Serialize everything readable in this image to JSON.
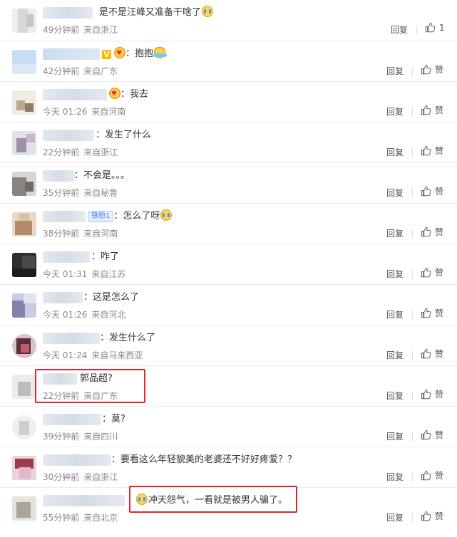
{
  "actions": {
    "reply_label": "回复",
    "like_label": "赞"
  },
  "colors": {
    "highlight": "#e8232b",
    "badge_blue": "#4b7ee8"
  },
  "comments": [
    {
      "text": "是不是汪峰又准备干啥了",
      "time": "49分钟前",
      "location": "来自浙江",
      "like": "1",
      "emoji_after": "cry-laugh"
    },
    {
      "text": "：抱抱",
      "time": "42分钟前",
      "location": "来自广东",
      "like": "赞",
      "emoji_before": "heart-eyes",
      "emoji_after": "hug"
    },
    {
      "text": "：我去",
      "time": "今天 01:26",
      "location": "来自河南",
      "like": "赞",
      "emoji_before": "heart-eyes"
    },
    {
      "text": "：发生了什么",
      "time": "22分钟前",
      "location": "来自浙江",
      "like": "赞"
    },
    {
      "text": "：不会是。。。",
      "time": "35分钟前",
      "location": "来自秘鲁",
      "like": "赞"
    },
    {
      "text": "：怎么了呀",
      "time": "38分钟前",
      "location": "来自河南",
      "like": "赞",
      "badge": "铁粉1",
      "emoji_after": "crying"
    },
    {
      "text": "：咋了",
      "time": "今天 01:31",
      "location": "来自江苏",
      "like": "赞"
    },
    {
      "text": "：这是怎么了",
      "time": "今天 01:26",
      "location": "来自河北",
      "like": "赞"
    },
    {
      "text": "：发生什么了",
      "time": "今天 01:24",
      "location": "来自马来西亚",
      "like": "赞"
    },
    {
      "text": "郭品超?",
      "time": "22分钟前",
      "location": "来自广东",
      "like": "赞"
    },
    {
      "text": "：莫?",
      "time": "39分钟前",
      "location": "来自四川",
      "like": "赞"
    },
    {
      "text": "：要看这么年轻貌美的老婆还不好好疼爱？？",
      "time": "30分钟前",
      "location": "来自浙江",
      "like": "赞"
    },
    {
      "text": "冲天怨气，一看就是被男人骗了。",
      "time": "55分钟前",
      "location": "来自北京",
      "like": "赞",
      "emoji_before": "cry-laugh"
    }
  ]
}
